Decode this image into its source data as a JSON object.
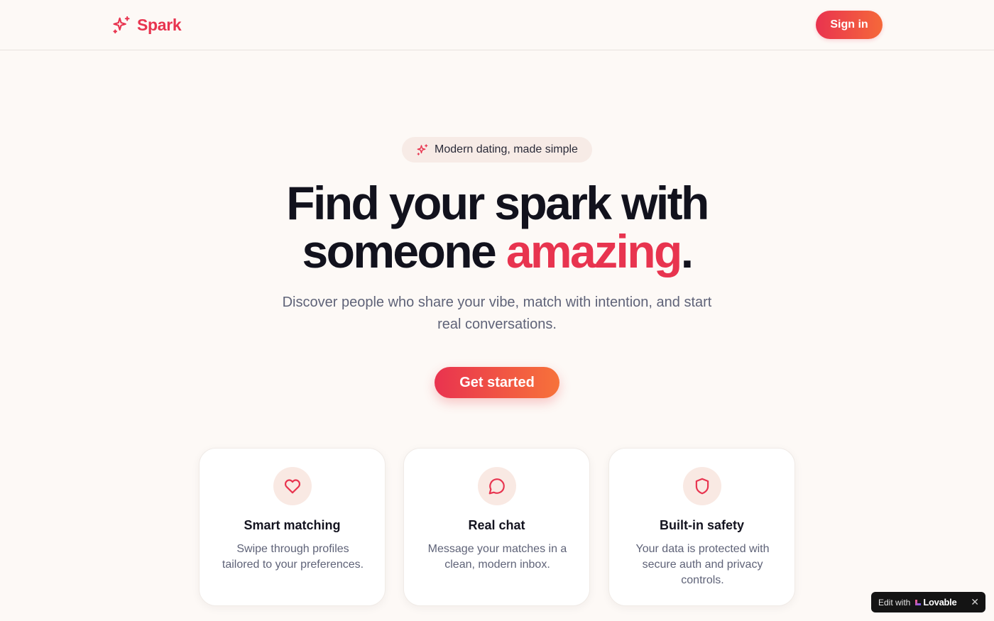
{
  "header": {
    "logo_text": "Spark",
    "signin_label": "Sign in"
  },
  "hero": {
    "badge_text": "Modern dating, made simple",
    "title_line1": "Find your spark with",
    "title_line2_prefix": "someone ",
    "title_accent": "amazing",
    "title_suffix": ".",
    "subtitle": "Discover people who share your vibe, match with intention, and start real conversations.",
    "cta_label": "Get started"
  },
  "features": [
    {
      "icon": "heart-icon",
      "title": "Smart matching",
      "description": "Swipe through profiles tailored to your preferences."
    },
    {
      "icon": "chat-bubble-icon",
      "title": "Real chat",
      "description": "Message your matches in a clean, modern inbox."
    },
    {
      "icon": "shield-icon",
      "title": "Built-in safety",
      "description": "Your data is protected with secure auth and privacy controls."
    }
  ],
  "lovable_badge": {
    "edit_text": "Edit with",
    "brand_text": "Lovable",
    "close_glyph": "✕"
  },
  "colors": {
    "accent": "#e8344f",
    "accent_orange": "#f5683a",
    "background": "#fdf9f6",
    "icon_bg": "#f9e9e3"
  }
}
